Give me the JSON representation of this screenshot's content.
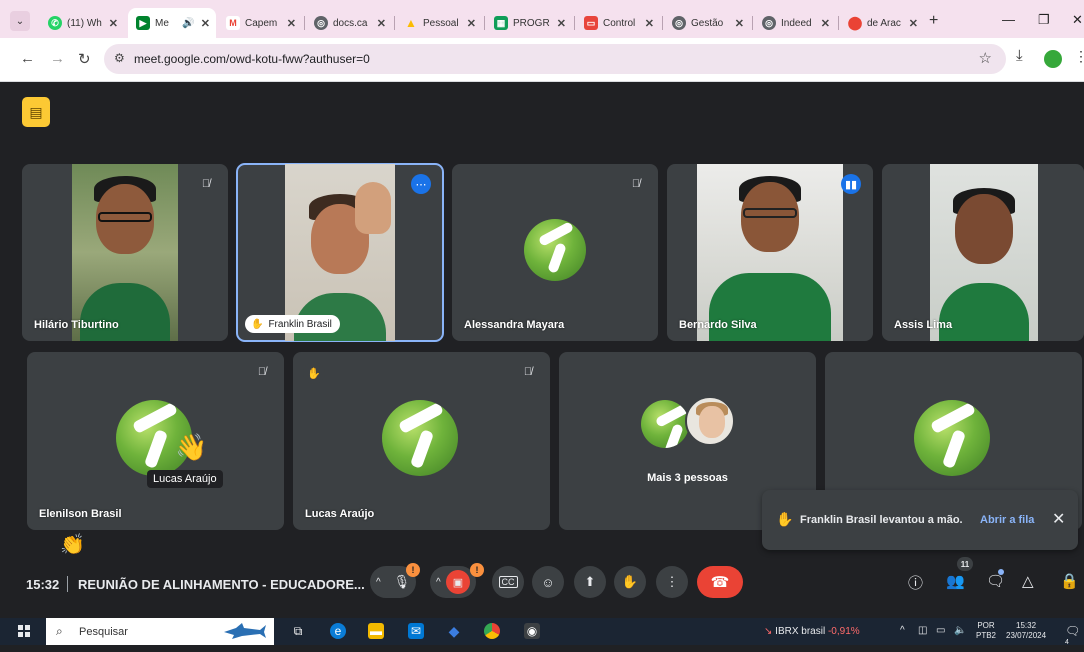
{
  "browser": {
    "tabs": [
      {
        "title": "(11) Wh",
        "favicon": "whatsapp-icon",
        "color": "#25d366"
      },
      {
        "title": "Me",
        "favicon": "meet-icon",
        "color": "#00832d",
        "active": true,
        "audio": "speaker-icon"
      },
      {
        "title": "Capem",
        "favicon": "gmail-icon",
        "color": "#ea4335"
      },
      {
        "title": "docs.ca",
        "favicon": "globe-icon",
        "color": "#5f6368"
      },
      {
        "title": "Pessoal",
        "favicon": "drive-icon",
        "color": "#fbbc04"
      },
      {
        "title": "PROGR",
        "favicon": "sheets-icon",
        "color": "#0f9d58"
      },
      {
        "title": "Control",
        "favicon": "slides-icon",
        "color": "#e8453c"
      },
      {
        "title": "Gestão",
        "favicon": "globe-icon",
        "color": "#5f6368"
      },
      {
        "title": "Indeed",
        "favicon": "globe-icon",
        "color": "#5f6368"
      },
      {
        "title": "de Arac",
        "favicon": "maps-icon",
        "color": "#ea4335"
      }
    ],
    "url": "meet.google.com/owd-kotu-fww?authuser=0"
  },
  "meet": {
    "participants_top": [
      {
        "name": "Hilário Tiburtino",
        "muted": true
      },
      {
        "name": "Franklin Brasil",
        "muted": false,
        "pinned_style": "chip"
      },
      {
        "name": "Alessandra Mayara",
        "muted": true
      },
      {
        "name": "Bernardo Silva",
        "muted": false
      },
      {
        "name": "Assis Lima",
        "muted": false
      }
    ],
    "participants_bottom": [
      {
        "name": "Elenilson Brasil",
        "overlay_label": "Lucas Araújo"
      },
      {
        "name": "Lucas Araújo"
      },
      {
        "name": "",
        "more_label": "Mais 3 pessoas"
      },
      {
        "name": ""
      }
    ],
    "toast": {
      "text": "Franklin Brasil levantou a mão.",
      "action": "Abrir a fila"
    },
    "controls": {
      "time": "15:32",
      "title": "REUNIÃO DE ALINHAMENTO - EDUCADORE...",
      "people_count": "11"
    }
  },
  "taskbar": {
    "search_placeholder": "Pesquisar",
    "stock_name": "IBRX brasil",
    "stock_change": "-0,91%",
    "lang_top": "POR",
    "lang_bottom": "PTB2",
    "time": "15:32",
    "date": "23/07/2024",
    "notification_count": "4"
  },
  "colors": {
    "meet_bg": "#202124",
    "tile_bg": "#3c4043",
    "active_outline": "#8ab4f8",
    "leave_red": "#ea4335",
    "warning_orange": "#fa903e",
    "hand_yellow": "#fcc934"
  }
}
